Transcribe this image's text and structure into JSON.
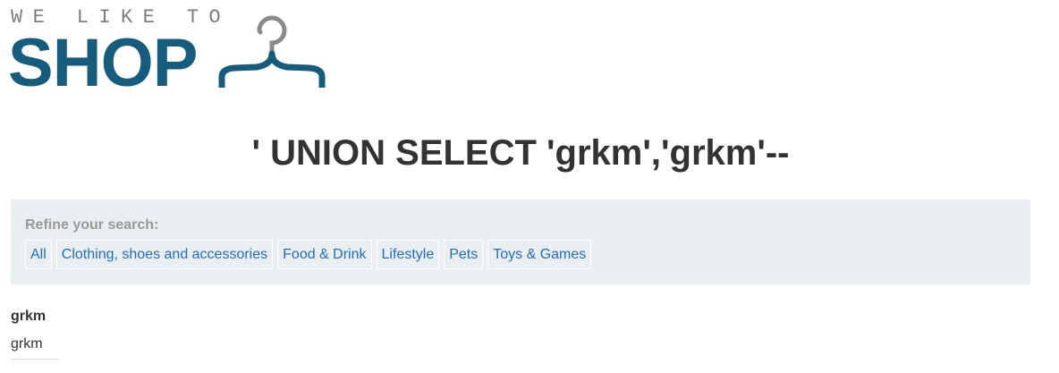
{
  "header": {
    "logo": {
      "tagline": "WE LIKE TO",
      "word": "SHOP",
      "icon": "hanger-icon",
      "colors": {
        "tagline": "#7d7d7d",
        "word": "#155c7d",
        "hanger_hook": "#8a8a8a",
        "hanger_body": "#155c7d"
      }
    }
  },
  "main": {
    "heading": "' UNION SELECT 'grkm','grkm'--",
    "filters": {
      "label": "Refine your search:",
      "items": [
        {
          "label": "All"
        },
        {
          "label": "Clothing, shoes and accessories"
        },
        {
          "label": "Food & Drink"
        },
        {
          "label": "Lifestyle"
        },
        {
          "label": "Pets"
        },
        {
          "label": "Toys & Games"
        }
      ],
      "colors": {
        "panel_bg": "#e9eef1",
        "link": "#1f6ebd"
      }
    },
    "results": [
      {
        "title": "grkm",
        "body": "grkm"
      }
    ]
  }
}
